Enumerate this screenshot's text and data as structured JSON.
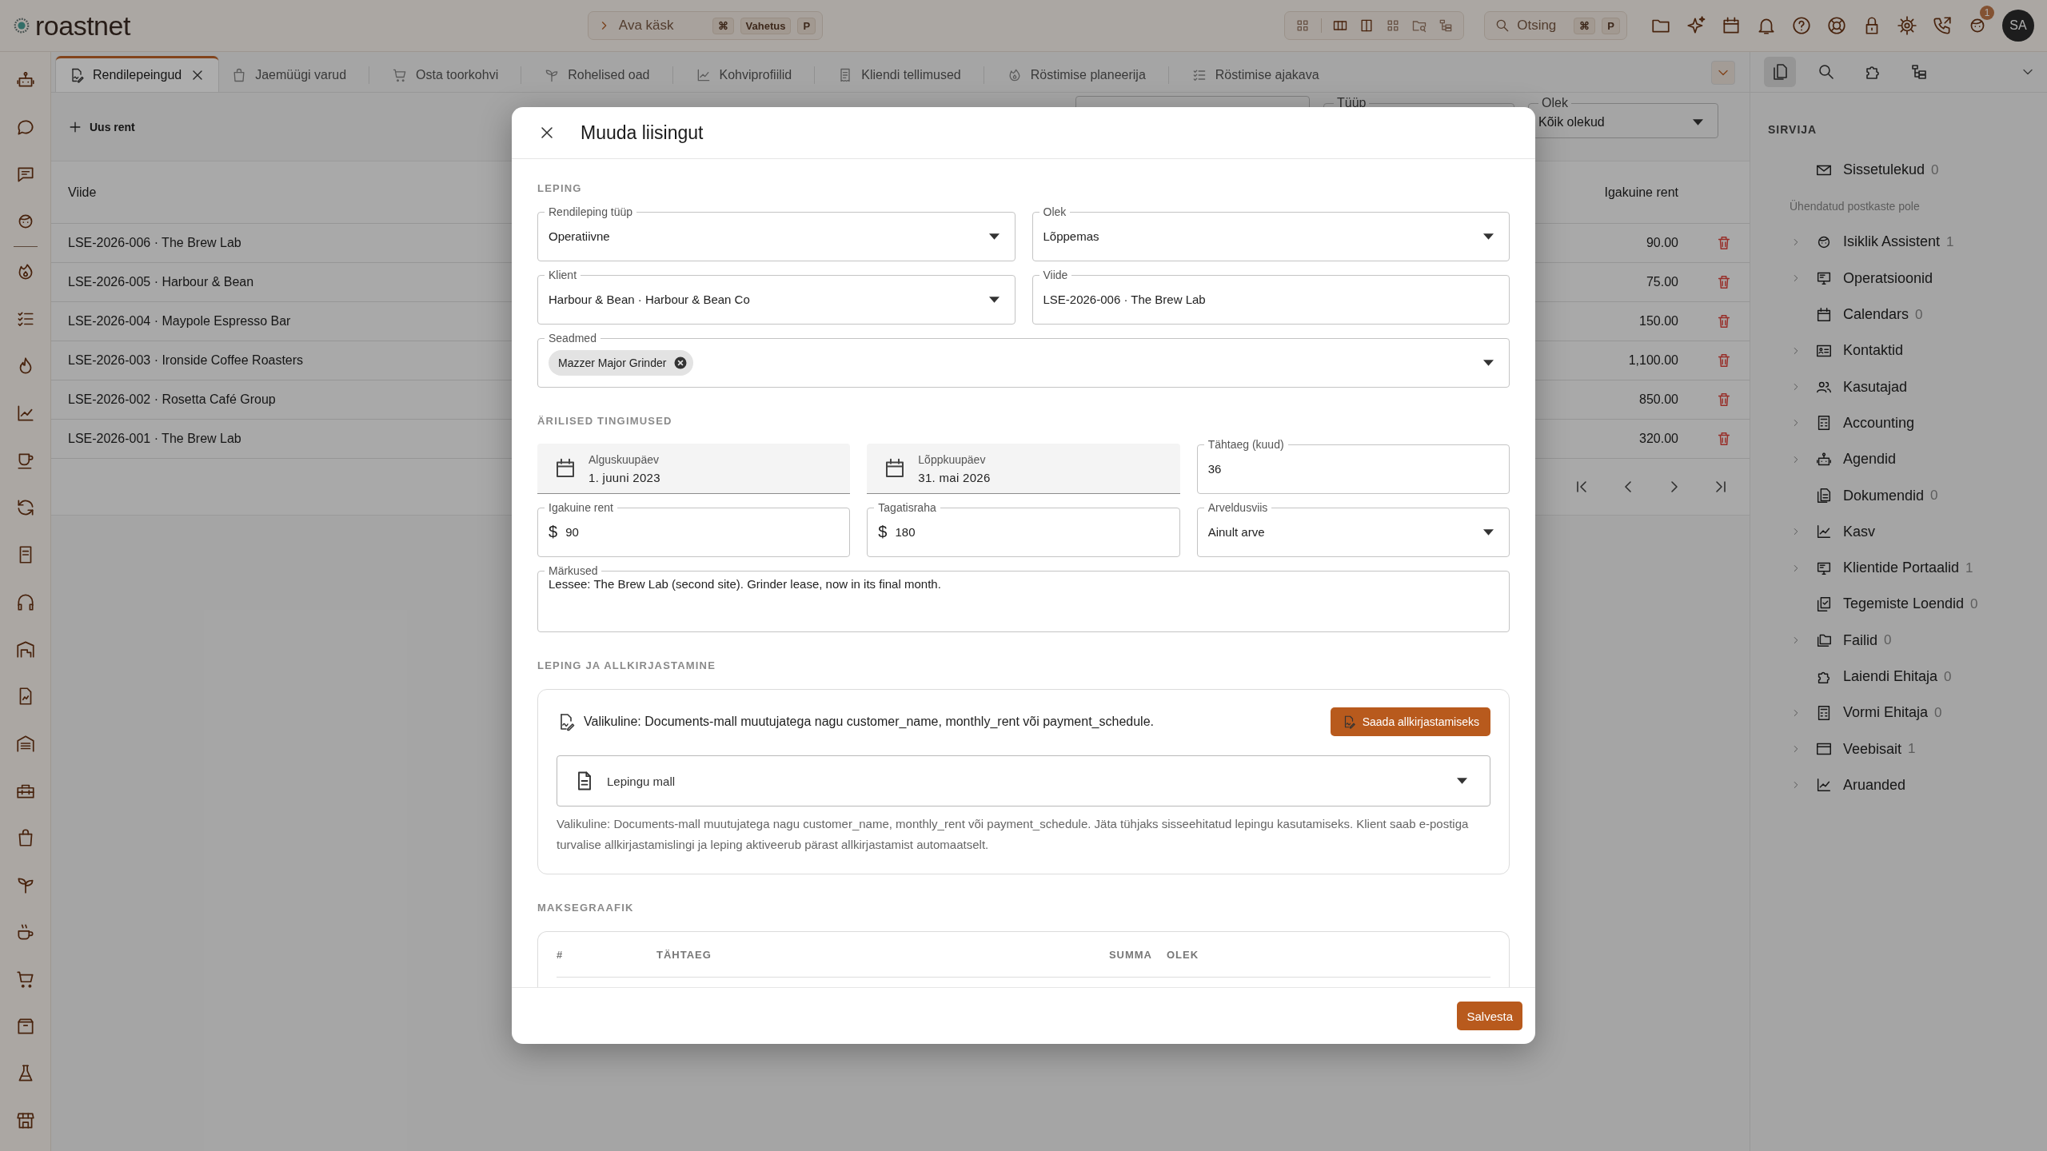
{
  "topbar": {
    "logo": "roastnet",
    "command": {
      "placeholder": "Ava käsk",
      "keys": [
        "⌘",
        "Vahetus",
        "P"
      ]
    },
    "search": {
      "placeholder": "Otsing",
      "keys": [
        "⌘",
        "P"
      ]
    },
    "notification_badge": "1",
    "avatar": "SA"
  },
  "tabs": [
    {
      "label": "Rendilepeingud",
      "selected": true
    },
    {
      "label": "Jaemüügi varud",
      "selected": false
    },
    {
      "label": "Osta toorkohvi",
      "selected": false
    },
    {
      "label": "Rohelised oad",
      "selected": false
    },
    {
      "label": "Kohviprofiilid",
      "selected": false
    },
    {
      "label": "Kliendi tellimused",
      "selected": false
    },
    {
      "label": "Röstimise planeerija",
      "selected": false
    },
    {
      "label": "Röstimise ajakava",
      "selected": false
    }
  ],
  "toolbar": {
    "new_button": "Uus rent",
    "filters": [
      {
        "kind": "plain"
      },
      {
        "kind": "select",
        "label": "Tüüp"
      },
      {
        "kind": "select",
        "label": "Olek",
        "value": "Kõik olekud"
      }
    ]
  },
  "table": {
    "columns": [
      "Viide",
      "Igakuine rent"
    ],
    "rows": [
      {
        "reference": "LSE-2026-006 · The Brew Lab",
        "monthly_rent": "90.00"
      },
      {
        "reference": "LSE-2026-005 · Harbour & Bean",
        "monthly_rent": "75.00"
      },
      {
        "reference": "LSE-2026-004 · Maypole Espresso Bar",
        "monthly_rent": "150.00"
      },
      {
        "reference": "LSE-2026-003 · Ironside Coffee Roasters",
        "monthly_rent": "1,100.00"
      },
      {
        "reference": "LSE-2026-002 · Rosetta Café Group",
        "monthly_rent": "850.00"
      },
      {
        "reference": "LSE-2026-001 · The Brew Lab",
        "monthly_rent": "320.00"
      }
    ]
  },
  "panel": {
    "tabs": [
      {
        "selected": true
      },
      {
        "selected": false
      },
      {
        "selected": false
      },
      {
        "selected": false
      }
    ],
    "title": "SIRVIJA",
    "inbox": {
      "label": "Sissetulekud",
      "count": "0"
    },
    "note": "Ühendatud postkaste pole",
    "items": [
      {
        "label": "Isiklik Assistent",
        "count": "1",
        "expandable": true
      },
      {
        "label": "Operatsioonid",
        "expandable": true
      },
      {
        "label": "Calendars",
        "count": "0",
        "expandable": false
      },
      {
        "label": "Kontaktid",
        "expandable": true
      },
      {
        "label": "Kasutajad",
        "expandable": true
      },
      {
        "label": "Accounting",
        "expandable": true
      },
      {
        "label": "Agendid",
        "expandable": true
      },
      {
        "label": "Dokumendid",
        "count": "0",
        "expandable": false
      },
      {
        "label": "Kasv",
        "expandable": true
      },
      {
        "label": "Klientide Portaalid",
        "count": "1",
        "expandable": true
      },
      {
        "label": "Tegemiste Loendid",
        "count": "0",
        "expandable": false
      },
      {
        "label": "Failid",
        "count": "0",
        "expandable": true
      },
      {
        "label": "Laiendi Ehitaja",
        "count": "0",
        "expandable": false
      },
      {
        "label": "Vormi Ehitaja",
        "count": "0",
        "expandable": true
      },
      {
        "label": "Veebisait",
        "count": "1",
        "expandable": true
      },
      {
        "label": "Aruanded",
        "expandable": true
      }
    ]
  },
  "modal": {
    "title": "Muuda liisingut",
    "sections": [
      {
        "kind": "form",
        "heading": "LEPING",
        "rows": [
          [
            {
              "kind": "select",
              "label": "Rendileping tüüp",
              "value": "Operatiivne"
            },
            {
              "kind": "select",
              "label": "Olek",
              "value": "Lõppemas"
            }
          ],
          [
            {
              "kind": "select",
              "label": "Klient",
              "value": "Harbour & Bean · Harbour & Bean Co"
            },
            {
              "kind": "text",
              "label": "Viide",
              "value": "LSE-2026-006 · The Brew Lab"
            }
          ],
          [
            {
              "kind": "chips",
              "label": "Seadmed",
              "chips": [
                "Mazzer Major Grinder"
              ]
            }
          ]
        ]
      },
      {
        "kind": "form",
        "heading": "ÄRILISED TINGIMUSED",
        "rows": [
          [
            {
              "kind": "date",
              "label": "Alguskuupäev",
              "value": "1. juuni 2023"
            },
            {
              "kind": "date",
              "label": "Lõppkuupäev",
              "value": "31. mai 2026"
            },
            {
              "kind": "text",
              "label": "Tähtaeg (kuud)",
              "value": "36"
            }
          ],
          [
            {
              "kind": "money",
              "label": "Igakuine rent",
              "prefix": "$",
              "value": "90"
            },
            {
              "kind": "money",
              "label": "Tagatisraha",
              "prefix": "$",
              "value": "180"
            },
            {
              "kind": "select",
              "label": "Arveldusviis",
              "value": "Ainult arve"
            }
          ],
          [
            {
              "kind": "textarea",
              "label": "Märkused",
              "value": "Lessee: The Brew Lab (second site). Grinder lease, now in its final month."
            }
          ]
        ]
      },
      {
        "kind": "contract",
        "heading": "LEPING JA ALLKIRJASTAMINE",
        "info": "Valikuline: Documents-mall muutujatega nagu customer_name, monthly_rent või payment_schedule.",
        "send_button": "Saada allkirjastamiseks",
        "template": {
          "placeholder": "Lepingu mall"
        },
        "help": "Valikuline: Documents-mall muutujatega nagu customer_name, monthly_rent või payment_schedule. Jäta tühjaks sisseehitatud lepingu kasutamiseks. Klient saab e-postiga turvalise allkirjastamislingi ja leping aktiveerub pärast allkirjastamist automaatselt."
      },
      {
        "kind": "schedule",
        "heading": "MAKSEGRAAFIK",
        "columns": [
          "#",
          "TÄHTAEG",
          "SUMMA",
          "OLEK"
        ]
      }
    ],
    "save_button": "Salvesta"
  }
}
